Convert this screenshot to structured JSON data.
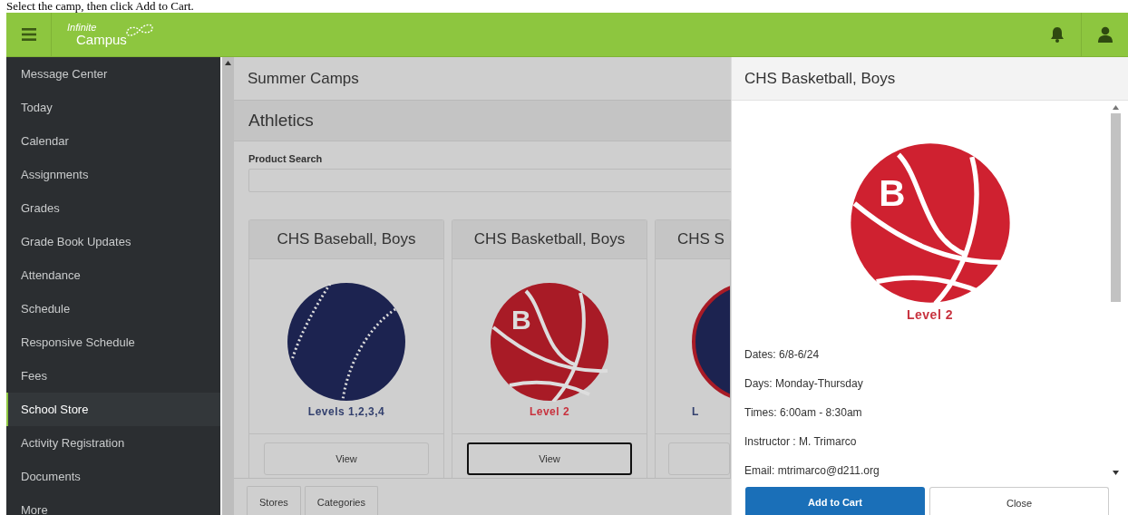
{
  "caption": "Select the camp, then click Add to Cart.",
  "header": {
    "logo_top": "Infinite",
    "logo_bottom": "Campus"
  },
  "sidebar": {
    "items": [
      {
        "label": "Message Center",
        "selected": false
      },
      {
        "label": "Today",
        "selected": false
      },
      {
        "label": "Calendar",
        "selected": false
      },
      {
        "label": "Assignments",
        "selected": false
      },
      {
        "label": "Grades",
        "selected": false
      },
      {
        "label": "Grade Book Updates",
        "selected": false
      },
      {
        "label": "Attendance",
        "selected": false
      },
      {
        "label": "Schedule",
        "selected": false
      },
      {
        "label": "Responsive Schedule",
        "selected": false
      },
      {
        "label": "Fees",
        "selected": false
      },
      {
        "label": "School Store",
        "selected": true
      },
      {
        "label": "Activity Registration",
        "selected": false
      },
      {
        "label": "Documents",
        "selected": false
      },
      {
        "label": "More",
        "selected": false
      }
    ]
  },
  "main": {
    "title": "Summer Camps",
    "category": "Athletics",
    "search": {
      "label": "Product Search"
    },
    "products": [
      {
        "kind": "baseball",
        "title": "CHS Baseball, Boys",
        "level_label": "Levels 1,2,3,4",
        "button": "View",
        "focused": false
      },
      {
        "kind": "basketball",
        "title": "CHS Basketball, Boys",
        "image_letter": "B",
        "level_label": "Level 2",
        "button": "View",
        "focused": true
      },
      {
        "kind": "soccer",
        "title": "CHS S",
        "level_label": "L",
        "focused": false
      }
    ],
    "tabs": [
      "Stores",
      "Categories"
    ]
  },
  "detail": {
    "title": "CHS Basketball, Boys",
    "kind": "basketball",
    "image_letter": "B",
    "level_label": "Level 2",
    "lines": [
      "Dates: 6/8-6/24",
      "Days: Monday-Thursday",
      "Times: 6:00am - 8:30am",
      "Instructor : M. Trimarco",
      "Email: mtrimarco@d211.org"
    ],
    "buttons": [
      {
        "label": "Add to Cart",
        "kind": "primary"
      },
      {
        "label": "Close",
        "kind": "secondary"
      }
    ]
  }
}
